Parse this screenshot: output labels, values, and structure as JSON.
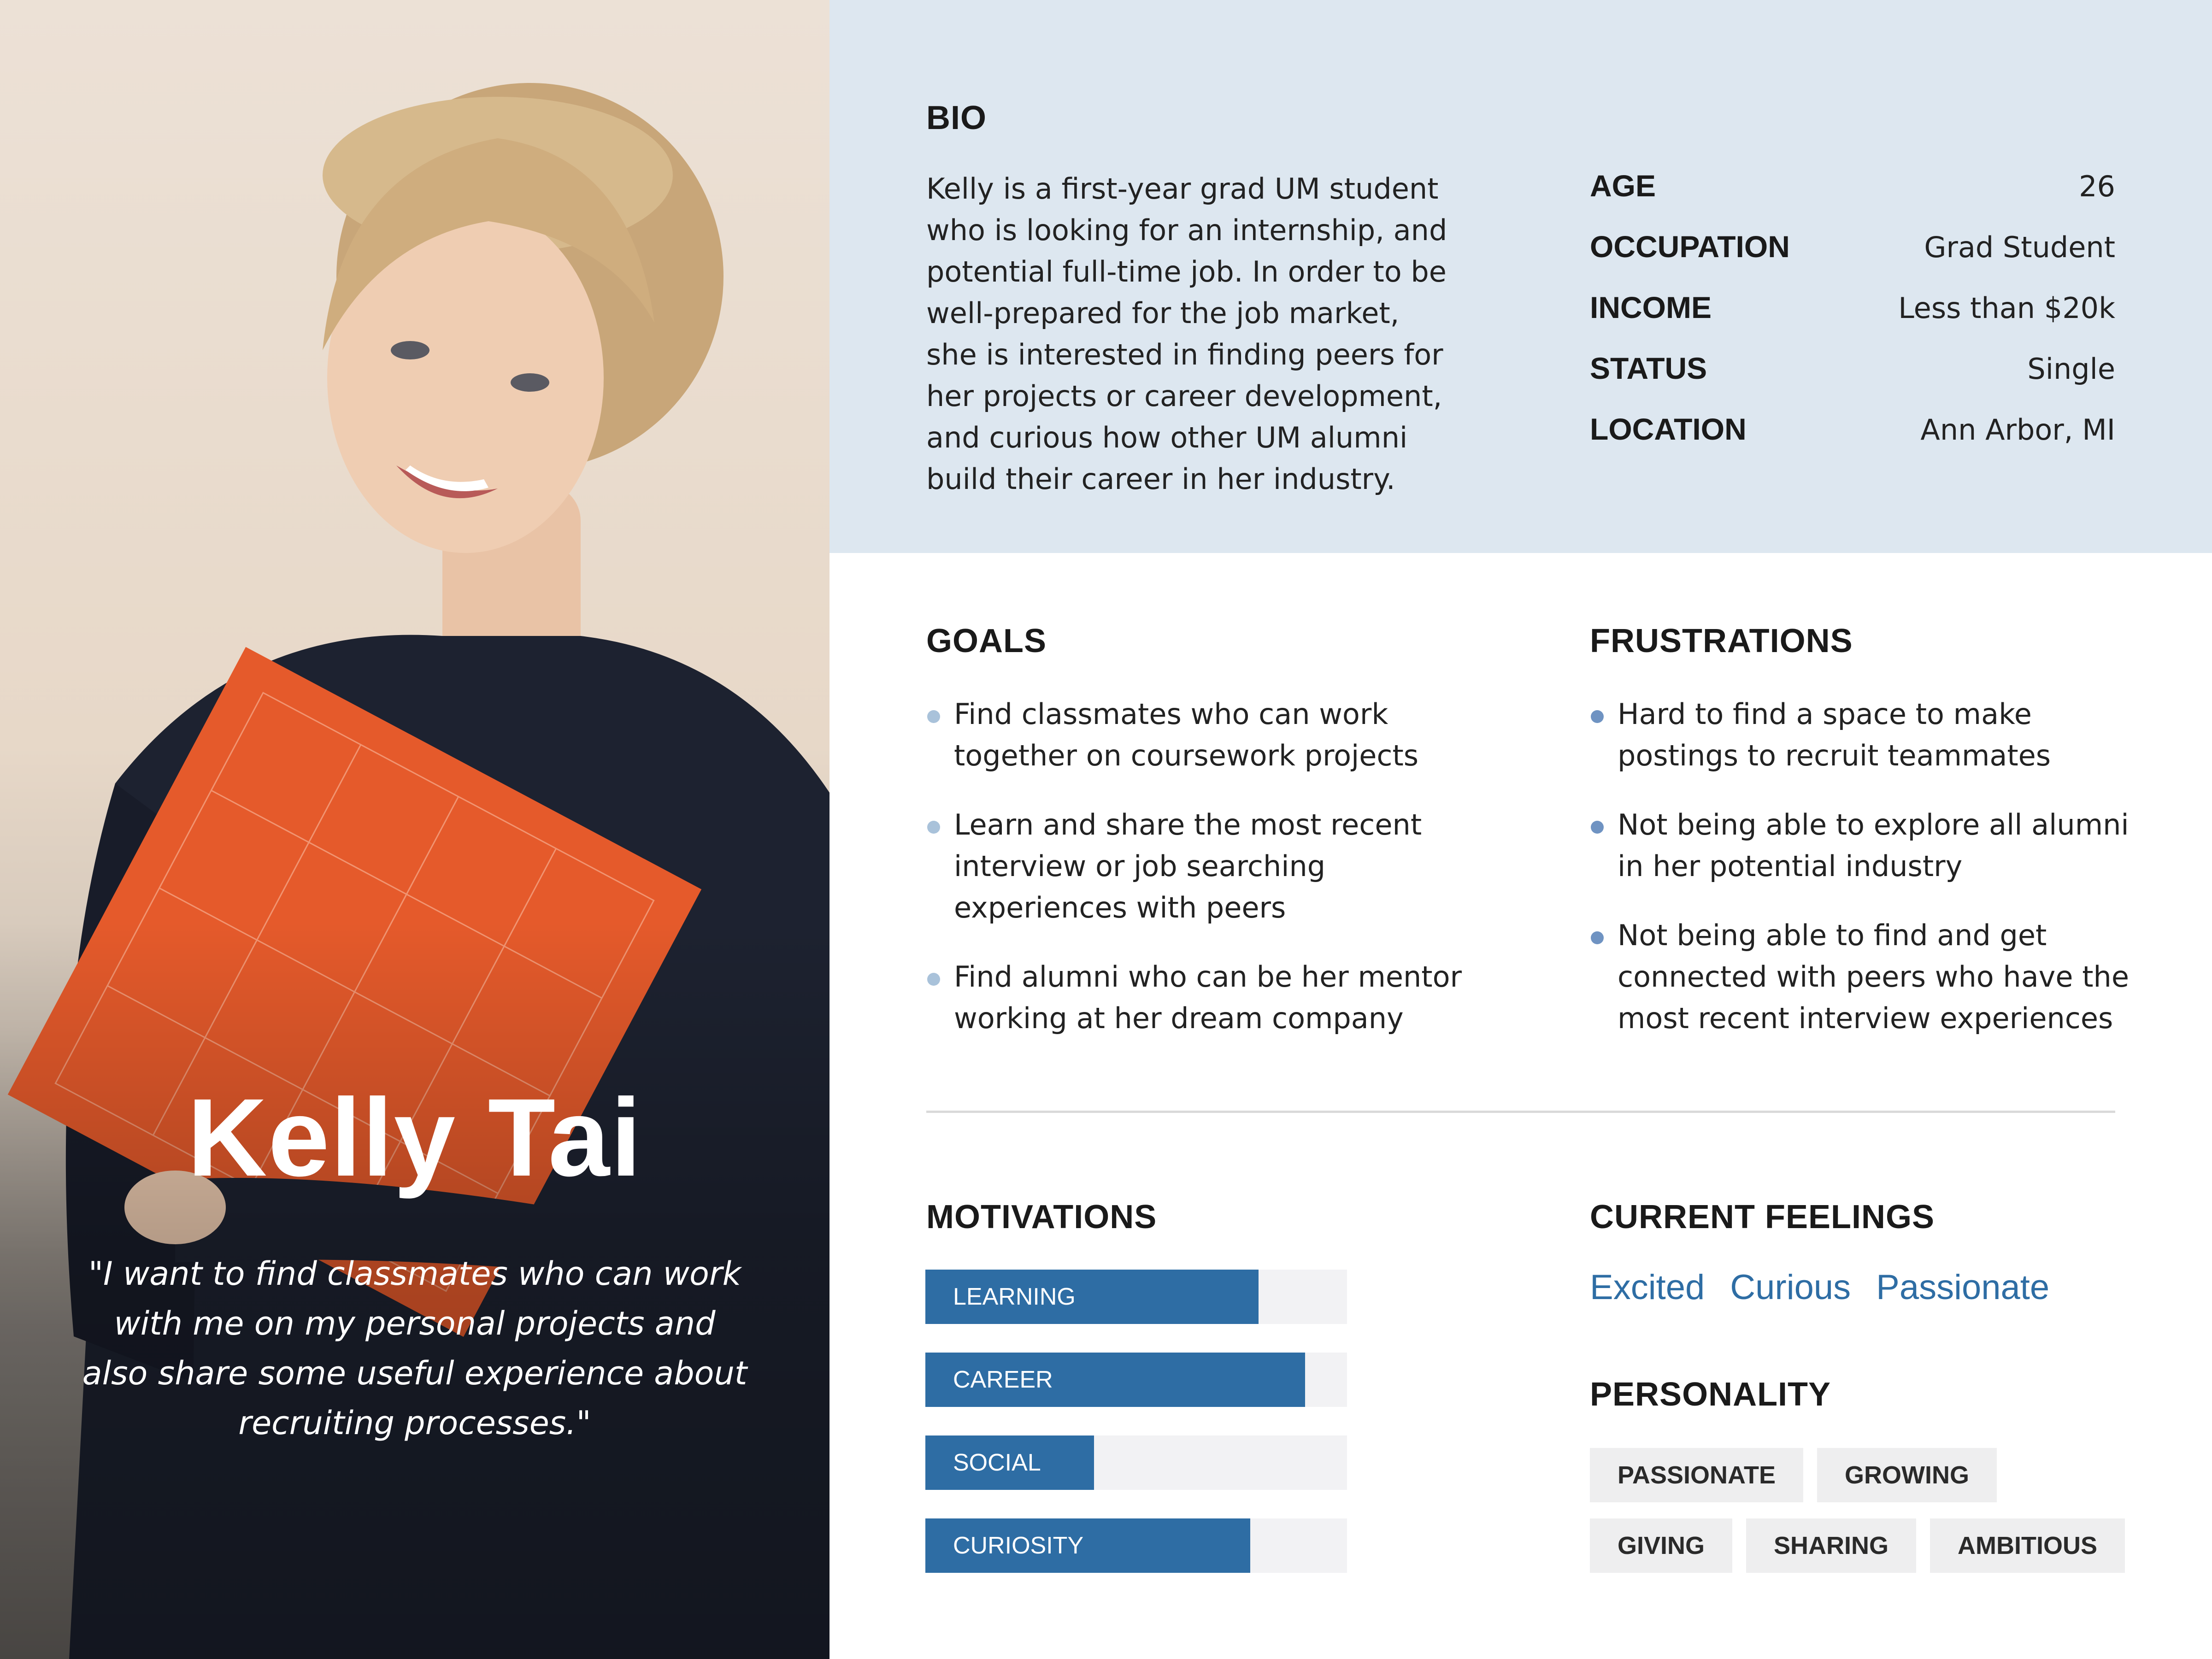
{
  "persona": {
    "name": "Kelly Tai",
    "quote": "\"I want to find classmates who can work with me on my personal projects and also share some useful experience about recruiting processes.\""
  },
  "bio": {
    "title": "BIO",
    "text": "Kelly is a first-year grad UM student who is looking for an internship, and potential full-time job. In order to be well-prepared for the job market, she is interested in finding peers for her projects or career development, and curious how other UM alumni build their career in her industry."
  },
  "facts": [
    {
      "label": "AGE",
      "value": "26"
    },
    {
      "label": "OCCUPATION",
      "value": "Grad Student"
    },
    {
      "label": "INCOME",
      "value": "Less than $20k"
    },
    {
      "label": "STATUS",
      "value": "Single"
    },
    {
      "label": "LOCATION",
      "value": "Ann Arbor, MI"
    }
  ],
  "goals": {
    "title": "GOALS",
    "bullet_color": "#a9c2da",
    "items": [
      "Find classmates who can work together on coursework projects",
      "Learn and share the most recent interview or job searching experiences with peers",
      "Find alumni who can be her mentor working at her dream company"
    ]
  },
  "frustrations": {
    "title": "FRUSTRATIONS",
    "bullet_color": "#6f93c2",
    "items": [
      "Hard to find a space to make postings to recruit teammates",
      "Not being able to explore all alumni in her potential industry",
      "Not being able to find and get connected with peers who have the most recent interview experiences"
    ]
  },
  "motivations": {
    "title": "MOTIVATIONS",
    "items": [
      {
        "label": "LEARNING",
        "level": 0.79
      },
      {
        "label": "CAREER",
        "level": 0.9
      },
      {
        "label": "SOCIAL",
        "level": 0.4
      },
      {
        "label": "CURIOSITY",
        "level": 0.77
      }
    ]
  },
  "feelings": {
    "title": "CURRENT FEELINGS",
    "items": [
      "Excited",
      "Curious",
      "Passionate"
    ]
  },
  "personality": {
    "title": "PERSONALITY",
    "rows": [
      [
        "PASSIONATE",
        "GROWING"
      ],
      [
        "GIVING",
        "SHARING",
        "AMBITIOUS"
      ]
    ]
  },
  "colors": {
    "accent": "#2e6da4",
    "bio_background": "#dde7f0",
    "book": "#e55a2b",
    "sweater": "#1d2230"
  }
}
